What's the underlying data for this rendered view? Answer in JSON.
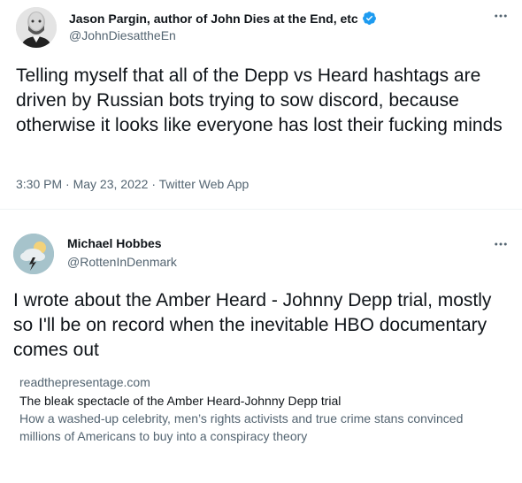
{
  "tweet1": {
    "author_name": "Jason Pargin, author of John Dies at the End, etc",
    "handle": "@JohnDiesattheEn",
    "text": "Telling myself that all of the Depp vs Heard hashtags are driven by Russian bots trying to sow discord, because otherwise it looks like everyone has lost their fucking minds",
    "time": "3:30 PM",
    "separator1": "·",
    "date": "May 23, 2022",
    "separator2": "·",
    "source": "Twitter Web App",
    "avatar_icon": "bald-man-avatar",
    "verified_icon": "verified-badge-icon",
    "more_icon": "more-horizontal-icon"
  },
  "tweet2": {
    "author_name": "Michael Hobbes",
    "handle": "@RottenInDenmark",
    "text": "I wrote about the Amber Heard - Johnny Depp trial, mostly so I'll be on record when the inevitable HBO documentary comes out",
    "avatar_icon": "storm-cloud-avatar",
    "more_icon": "more-horizontal-icon",
    "link_card": {
      "domain": "readthepresentage.com",
      "title": "The bleak spectacle of the Amber Heard-Johnny Depp trial",
      "description": "How a washed-up celebrity, men’s rights activists and true crime stans convinced millions of Americans to buy into a conspiracy theory"
    }
  },
  "colors": {
    "primary_text": "#0f1419",
    "secondary_text": "#536471",
    "verified_blue": "#1d9bf0",
    "divider": "#eff3f4"
  }
}
